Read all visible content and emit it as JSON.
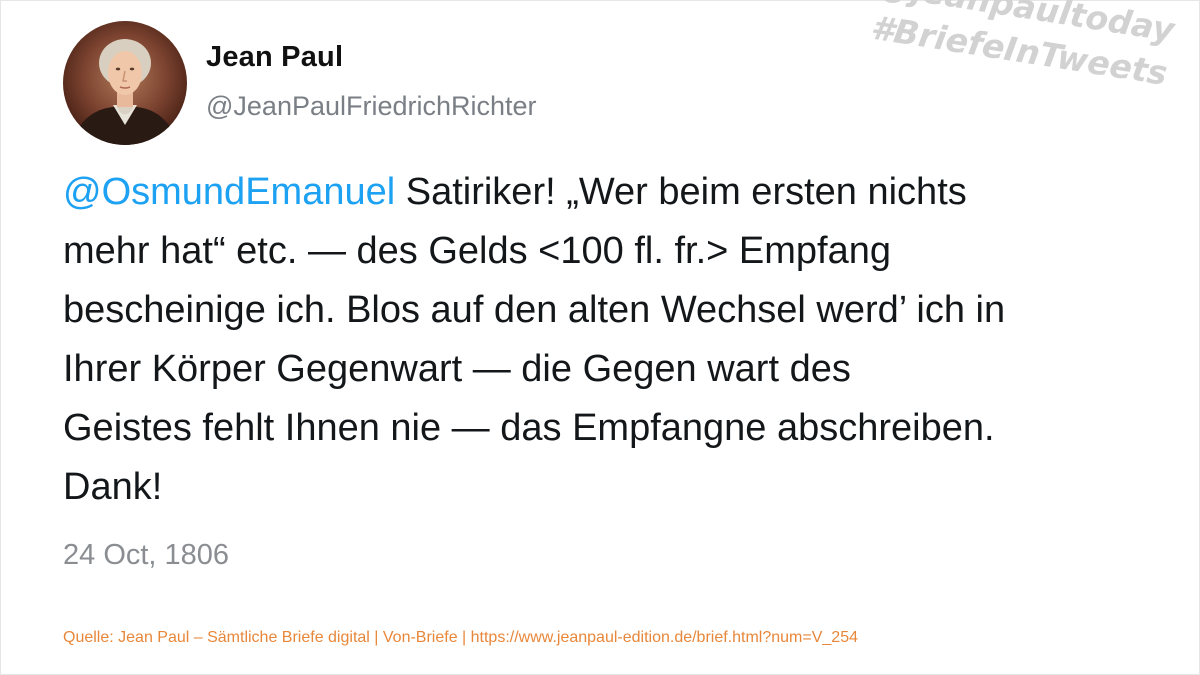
{
  "author": {
    "name": "Jean Paul",
    "handle": "@JeanPaulFriedrichRichter",
    "avatar_icon": "portrait-avatar"
  },
  "watermark": {
    "line1": "@jeanpaultoday",
    "line2": "#BriefeInTweets"
  },
  "tweet": {
    "mention": "@OsmundEmanuel",
    "line1_rest": " Satiriker! „Wer beim ersten nichts",
    "line2": "mehr hat“ etc. — des Gelds <100 fl. fr.> Empfang",
    "line3": "bescheinige ich. Blos auf den alten Wechsel werd’ ich in",
    "line4": "Ihrer Körper Gegenwart — die Gegen wart des",
    "line5": "Geistes fehlt Ihnen nie — das Empfangne abschreiben.",
    "line6": "Dank!",
    "date": "24 Oct, 1806"
  },
  "source": "Quelle: Jean Paul – Sämtliche Briefe digital | Von-Briefe | https://www.jeanpaul-edition.de/brief.html?num=V_254",
  "colors": {
    "mention": "#1da1f2",
    "source": "#e8873a",
    "watermark": "#d2d2d2"
  }
}
